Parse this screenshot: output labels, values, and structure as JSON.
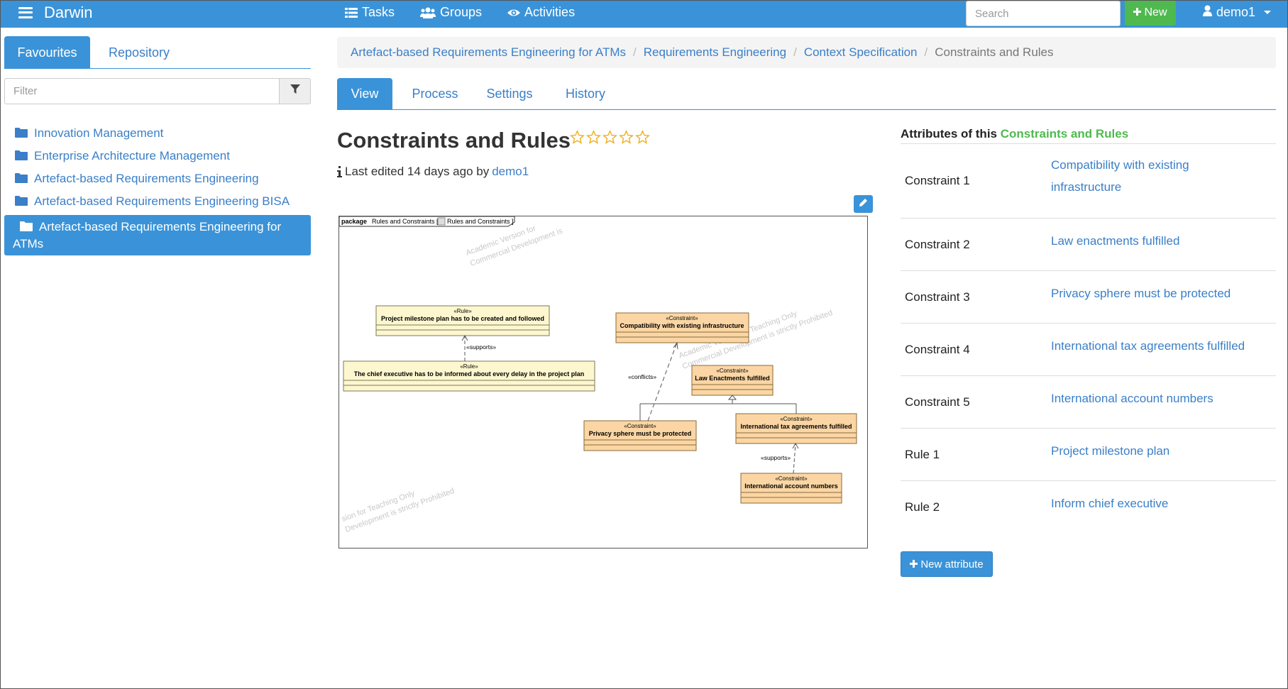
{
  "app": {
    "name": "Darwin"
  },
  "nav": {
    "tasks": "Tasks",
    "groups": "Groups",
    "activities": "Activities",
    "search_placeholder": "Search",
    "new_label": "New",
    "user": "demo1"
  },
  "sidebar": {
    "tabs": {
      "favourites": "Favourites",
      "repository": "Repository"
    },
    "filter_placeholder": "Filter",
    "items": [
      {
        "label": "Innovation Management"
      },
      {
        "label": "Enterprise Architecture Management"
      },
      {
        "label": "Artefact-based Requirements Engineering"
      },
      {
        "label": "Artefact-based Requirements Engineering BISA"
      },
      {
        "label": "Artefact-based Requirements Engineering for ATMs",
        "active": true
      }
    ]
  },
  "breadcrumb": {
    "items": [
      "Artefact-based Requirements Engineering for ATMs",
      "Requirements Engineering",
      "Context Specification"
    ],
    "current": "Constraints and Rules"
  },
  "tabs": {
    "view": "View",
    "process": "Process",
    "settings": "Settings",
    "history": "History"
  },
  "page": {
    "title": "Constraints and Rules",
    "rating": {
      "filled": 0,
      "max": 5
    },
    "last_edited_prefix": "Last edited 14 days ago by",
    "last_edited_user": "demo1"
  },
  "diagram": {
    "frame_keyword": "package",
    "frame_name": "Rules and Constraints [",
    "frame_ref": "Rules and Constraints ]",
    "watermark_1a": "Academic Version for",
    "watermark_1b": "Commercial Development is",
    "watermark_2a": "Academic Version for Teaching Only",
    "watermark_2b": "Commercial Development is strictly Prohibited",
    "watermark_3a": "sion for Teaching Only",
    "watermark_3b": "Development is strictly Prohibited",
    "stereo_rule": "«Rule»",
    "stereo_constraint": "«Constraint»",
    "rule1": "Project milestone plan has to be created and followed",
    "rule2": "The chief executive has to be informed about every delay in the project plan",
    "c_compat": "Compatibility with existing infrastructure",
    "c_law": "Law Enactments fulfilled",
    "c_privacy": "Privacy sphere must be protected",
    "c_tax": "International tax agreements fulfilled",
    "c_account": "International account numbers",
    "label_supports": "«supports»",
    "label_conflicts": "«conflicts»"
  },
  "attributes": {
    "heading_prefix": "Attributes of this",
    "heading_accent": "Constraints and Rules",
    "rows": [
      {
        "key": "Constraint 1",
        "value": "Compatibility with existing infrastructure"
      },
      {
        "key": "Constraint 2",
        "value": "Law enactments fulfilled"
      },
      {
        "key": "Constraint 3",
        "value": "Privacy sphere must be protected"
      },
      {
        "key": "Constraint 4",
        "value": "International tax agreements fulfilled"
      },
      {
        "key": "Constraint 5",
        "value": "International account numbers"
      },
      {
        "key": "Rule 1",
        "value": "Project milestone plan"
      },
      {
        "key": "Rule 2",
        "value": "Inform chief executive"
      }
    ],
    "new_button": "New attribute"
  },
  "colors": {
    "primary": "#3a93d8",
    "success": "#4fb94f",
    "link": "#3a7fc8",
    "rule_fill": "#fdf7cf",
    "constraint_fill": "#fbd6a4",
    "star": "#f0ad1e"
  }
}
